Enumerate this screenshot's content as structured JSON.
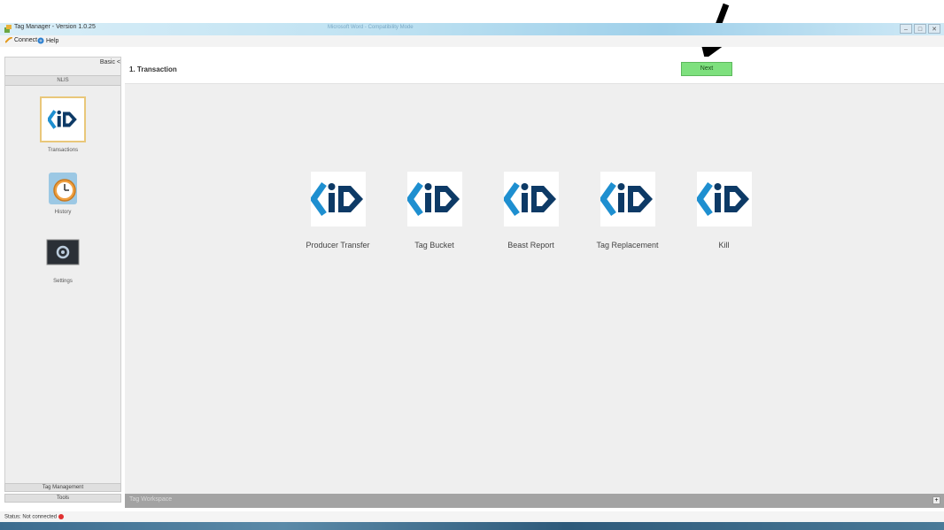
{
  "window": {
    "title": "Tag Manager - Version 1.0.25",
    "center_title": "Microsoft Word - Compatibility Mode",
    "buttons": [
      "–",
      "□",
      "✕"
    ]
  },
  "menu": {
    "connect": "Connect",
    "help": "Help"
  },
  "sidebar": {
    "header": "Basic <",
    "subheader": "NLIS",
    "items": [
      {
        "label": "Transactions",
        "icon": "nlis-logo-icon"
      },
      {
        "label": "History",
        "icon": "clock-icon"
      },
      {
        "label": "Settings",
        "icon": "settings-icon"
      }
    ],
    "bottom_tabs": [
      "Tag Management",
      "Tools"
    ]
  },
  "main": {
    "title": "1. Transaction",
    "next_label": "Next",
    "tiles": [
      {
        "label": "Producer Transfer",
        "icon": "nlis-logo-icon"
      },
      {
        "label": "Tag Bucket",
        "icon": "nlis-logo-icon"
      },
      {
        "label": "Beast Report",
        "icon": "nlis-logo-icon"
      },
      {
        "label": "Tag Replacement",
        "icon": "nlis-logo-icon"
      },
      {
        "label": "Kill",
        "icon": "nlis-logo-icon"
      }
    ]
  },
  "workspace": {
    "label": "Tag Workspace",
    "expand": "+"
  },
  "status": {
    "text": "Status: Not connected"
  },
  "colors": {
    "next_button": "#7ee07e",
    "logo_light": "#1e8fd0",
    "logo_dark": "#0d3a66",
    "status_dot": "#e03030"
  }
}
